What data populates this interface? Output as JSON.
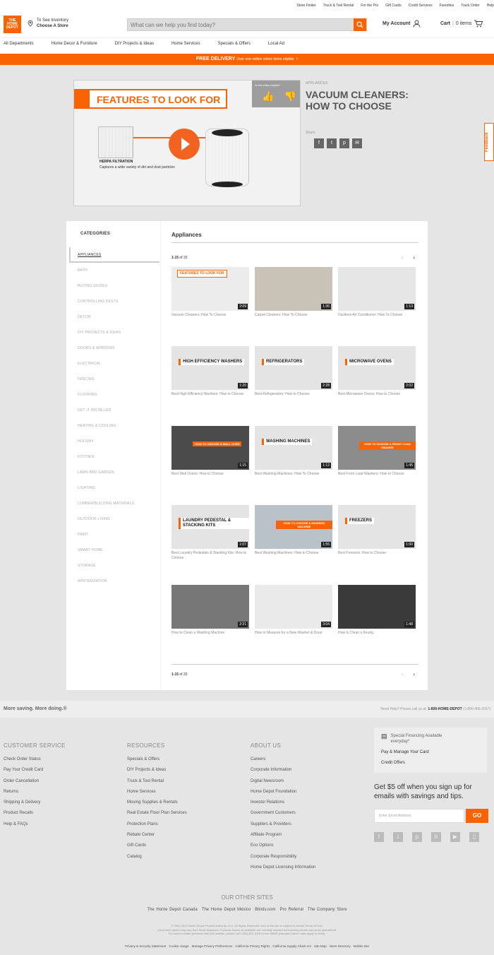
{
  "util_links": [
    "Store Finder",
    "Truck & Tool Rental",
    "For the Pro",
    "Gift Cards",
    "Credit Services",
    "Favorites",
    "Track Order",
    "Help"
  ],
  "header": {
    "logo_text": "THE HOME DEPOT",
    "store_line1": "To See Inventory",
    "store_line2": "Choose A Store",
    "search_placeholder": "What can we help you find today?",
    "account": "My Account",
    "cart": "Cart",
    "cart_items": "0 items"
  },
  "nav": [
    "All Departments",
    "Home Decor & Furniture",
    "DIY Projects & Ideas",
    "Home Services",
    "Specials & Offers",
    "Local Ad"
  ],
  "promo": {
    "bold": "FREE DELIVERY",
    "text": "Over one million online items eligible.",
    "arrow": "›"
  },
  "video": {
    "heading": "FEATURES TO LOOK FOR",
    "helpful": "Is this video helpful?",
    "feature_title": "HERPA FILTRATION",
    "feature_desc": "Captures a wide variety of dirt and dust particles"
  },
  "article": {
    "category": "APPLIANCES",
    "title": "VACUUM CLEANERS: HOW TO CHOOSE",
    "share": "Share:"
  },
  "feedback": "Feedback",
  "sidebar": {
    "title": "CATEGORIES",
    "items": [
      "APPLIANCES",
      "BATH",
      "BUYING GUIDES",
      "CONTROLLING PESTS",
      "DECOR",
      "DIY PROJECTS & IDEAS",
      "DOORS & WINDOWS",
      "ELECTRICAL",
      "FENCING",
      "FLOORING",
      "GET IT INSTALLED",
      "HEATING & COOLING",
      "HOLIDAY",
      "KITCHEN",
      "LAWN AND GARDEN",
      "LIGHTING",
      "LUMBER/BUILDING MATERIALS",
      "OUTDOOR LIVING",
      "PAINT",
      "SMART HOME",
      "STORAGE",
      "WINTERIZATION"
    ]
  },
  "main": {
    "title": "Appliances",
    "range": "1-15",
    "of": "of",
    "total": "33",
    "prev": "‹",
    "next": "›"
  },
  "videos": [
    {
      "title": "Vacuum Cleaners: How To Choose",
      "duration": "2:09",
      "label": "FEATURES TO LOOK FOR",
      "bg": "#ececec"
    },
    {
      "title": "Carpet Cleaners: How To Choose",
      "duration": "1:36",
      "label": "",
      "bg": "#c9c2b6"
    },
    {
      "title": "Ductless Air Conditioner: How To Choose",
      "duration": "1:13",
      "label": "",
      "bg": "#e6e6e6"
    },
    {
      "title": "Best High Efficiency Washers: How to Choose",
      "duration": "1:20",
      "label": "HIGH EFFICIENCY WASHERS",
      "bg": "#e4e4e4"
    },
    {
      "title": "Best Refrigerators: How to Choose",
      "duration": "2:28",
      "label": "REFRIGERATORS",
      "bg": "#e4e4e4"
    },
    {
      "title": "Best Microwave Ovens: How to Choose",
      "duration": "2:02",
      "label": "MICROWAVE OVENS",
      "bg": "#e4e4e4"
    },
    {
      "title": "Best Wall Ovens: How to Choose",
      "duration": "1:15",
      "label": "HOW TO CHOOSE A WALL OVEN",
      "bg": "#4b4b4b"
    },
    {
      "title": "Best Washing Machines: How To Choose",
      "duration": "1:12",
      "label": "WASHING MACHINES",
      "bg": "#e4e4e4"
    },
    {
      "title": "Best Front Load Washers: How to Choose",
      "duration": "1:45",
      "label": "HOW TO CHOOSE A FRONT LOAD WASHER",
      "bg": "#8c8c8c"
    },
    {
      "title": "Best Laundry Pedestals & Stacking Kits: How to Choose",
      "duration": "1:07",
      "label": "LAUNDRY PEDESTAL & STACKING KITS",
      "bg": "#e4e4e4"
    },
    {
      "title": "Best Washing Machines: How to Choose",
      "duration": "1:55",
      "label": "HOW TO CHOOSE A WASHING MACHINE",
      "bg": "#b9c2c8"
    },
    {
      "title": "Best Freezers: How to Choose",
      "duration": "1:00",
      "label": "FREEZERS",
      "bg": "#e4e4e4"
    },
    {
      "title": "How to Clean a Washing Machine",
      "duration": "2:21",
      "label": "",
      "bg": "#777"
    },
    {
      "title": "How to Measure for a New Washer & Dryer",
      "duration": "3:04",
      "label": "",
      "bg": "#eaeaea"
    },
    {
      "title": "How to Clean a Keurig",
      "duration": "1:48",
      "label": "",
      "bg": "#3a3a3a"
    }
  ],
  "footer_bar": {
    "slogan": "More saving. More doing.®",
    "help": "Need Help? Please call us at:",
    "phone": "1-800-HOME-DEPOT",
    "phone2": "(1-800-466-3337)"
  },
  "footer": {
    "customer_service": {
      "title": "CUSTOMER SERVICE",
      "links": [
        "Check Order Status",
        "Pay Your Credit Card",
        "Order Cancellation",
        "Returns",
        "Shipping & Delivery",
        "Product Recalls",
        "Help & FAQs"
      ]
    },
    "resources": {
      "title": "RESOURCES",
      "links": [
        "Specials & Offers",
        "DIY Projects & Ideas",
        "Truck & Tool Rental",
        "Home Services",
        "Moving Supplies & Rentals",
        "Real Estate Floor Plan Services",
        "Protection Plans",
        "Rebate Center",
        "Gift Cards",
        "Catalog"
      ]
    },
    "about": {
      "title": "ABOUT US",
      "links": [
        "Careers",
        "Corporate Information",
        "Digital Newsroom",
        "Home Depot Foundation",
        "Investor Relations",
        "Government Customers",
        "Suppliers & Providers",
        "Affiliate Program",
        "Eco Options",
        "Corporate Responsibility",
        "Home Depot Licensing Information"
      ]
    },
    "financing": {
      "line1": "Special Financing Available",
      "line2": "everyday*",
      "link1": "Pay & Manage Your Card",
      "link2": "Credit Offers"
    },
    "signup": "Get $5 off when you sign up for emails with savings and tips.",
    "email_placeholder": "Enter Email Address",
    "go": "GO",
    "other_title": "OUR OTHER SITES",
    "other_sites": [
      "The Home Depot Canada",
      "The Home Depot México",
      "Blinds.com",
      "Pro Referral",
      "The Company Store"
    ],
    "legal": [
      "© 2000-2019 Home Depot Product Authority, LLC. All Rights Reserved. Use of this site is subject to certain Terms Of Use.",
      "Local store prices may vary from those displayed. Products shown as available are normally stocked but inventory levels cannot be guaranteed.",
      "For screen reader problems with this website, please call 1-800-430-3376 or text 38698 (standard carrier rates apply to texts)."
    ],
    "legal_links": [
      "Privacy & Security Statement",
      "Cookie Usage",
      "Manage Privacy Preferences",
      "California Privacy Rights",
      "California Supply Chain Act",
      "Site Map",
      "Store Directory",
      "Mobile Site"
    ]
  }
}
